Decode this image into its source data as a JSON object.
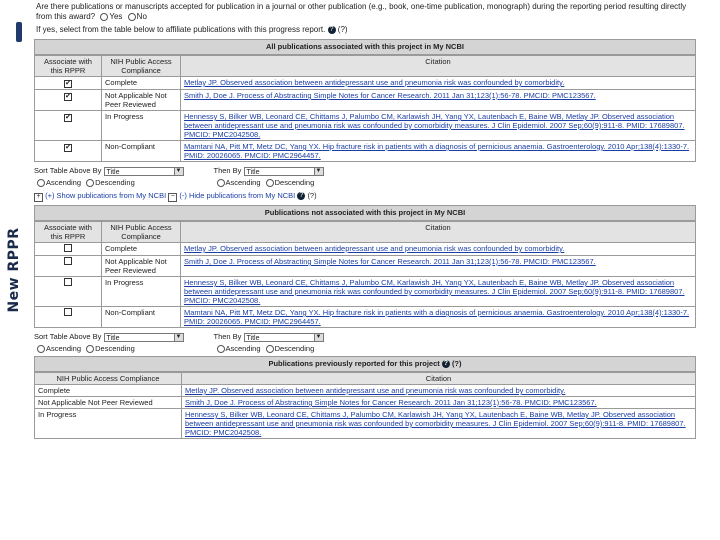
{
  "slide_title": "New RPPR",
  "question": {
    "text": "Are there publications or manuscripts accepted for publication in a journal or other publication (e.g., book, one-time publication, monograph) during the reporting period resulting directly from this award?",
    "yes": "Yes",
    "no": "No",
    "instruction": "If yes, select from the table below to affiliate publications with this progress report.",
    "help_q": "(?)"
  },
  "table1": {
    "caption": "All publications associated with this project in My NCBI",
    "headers": [
      "Associate with this RPPR",
      "NIH Public Access Compliance",
      "Citation"
    ],
    "rows": [
      {
        "checked": "✔",
        "compliance": "Complete",
        "citation": "Metlay JP. Observed association between antidepressant use and pneumonia risk was confounded by comorbidity."
      },
      {
        "checked": "✔",
        "compliance": "Not Applicable Not Peer Reviewed",
        "citation": "Smith J, Doe J. Process of Abstracting Simple Notes for Cancer Research. 2011 Jan 31;123(1):56-78. PMCID: PMC123567."
      },
      {
        "checked": "✔",
        "compliance": "In Progress",
        "citation": "Hennessy S, Bilker WB, Leonard CE, Chittams J, Palumbo CM, Karlawish JH, Yang YX, Lautenbach E, Baine WB, Metlay JP. Observed association between antidepressant use and pneumonia risk was confounded by comorbidity measures. J Clin Epidemiol. 2007 Sep;60(9):911-8. PMID: 17689807. PMCID: PMC2042508."
      },
      {
        "checked": "✔",
        "compliance": "Non-Compliant",
        "citation": "Mamtani NA, Pitt MT, Metz DC, Yang YX. Hip fracture risk in patients with a diagnosis of pernicious anaemia. Gastroenterology. 2010 Apr;138(4):1330-7. PMID: 20026065. PMCID: PMC2964457."
      }
    ]
  },
  "sort1": {
    "label": "Sort Table Above By",
    "value": "Title",
    "then": "Then By",
    "then_value": "Title",
    "asc": "Ascending",
    "desc": "Descending"
  },
  "links": {
    "show": "(+) Show publications from My NCBI",
    "hide": "(-) Hide publications from My NCBI",
    "help": "(?)"
  },
  "table2": {
    "caption": "Publications not associated with this project in My NCBI",
    "headers": [
      "Associate with this RPPR",
      "NIH Public Access Compliance",
      "Citation"
    ],
    "rows": [
      {
        "compliance": "Complete",
        "citation": "Metlay JP. Observed association between antidepressant use and pneumonia risk was confounded by comorbidity."
      },
      {
        "compliance": "Not Applicable Not Peer Reviewed",
        "citation": "Smith J, Doe J. Process of Abstracting Simple Notes for Cancer Research. 2011 Jan 31;123(1):56-78. PMCID: PMC123567."
      },
      {
        "compliance": "In Progress",
        "citation": "Hennessy S, Bilker WB, Leonard CE, Chittams J, Palumbo CM, Karlawish JH, Yang YX, Lautenbach E, Baine WB, Metlay JP. Observed association between antidepressant use and pneumonia risk was confounded by comorbidity measures. J Clin Epidemiol. 2007 Sep;60(9):911-8. PMID: 17689807. PMCID: PMC2042508."
      },
      {
        "compliance": "Non-Compliant",
        "citation": "Mamtani NA, Pitt MT, Metz DC, Yang YX. Hip fracture risk in patients with a diagnosis of pernicious anaemia. Gastroenterology. 2010 Apr;138(4):1330-7. PMID: 20026065. PMCID: PMC2964457."
      }
    ]
  },
  "sort2": {
    "label": "Sort Table Above By",
    "value": "Title",
    "then": "Then By",
    "then_value": "Title",
    "asc": "Ascending",
    "desc": "Descending"
  },
  "table3": {
    "caption": "Publications previously reported for this project",
    "help": "(?)",
    "headers": [
      "NIH Public Access Compliance",
      "Citation"
    ],
    "rows": [
      {
        "compliance": "Complete",
        "citation": "Metlay JP. Observed association between antidepressant use and pneumonia risk was confounded by comorbidity."
      },
      {
        "compliance": "Not Applicable Not Peer Reviewed",
        "citation": "Smith J, Doe J. Process of Abstracting Simple Notes for Cancer Research. 2011 Jan 31;123(1):56-78. PMCID: PMC123567."
      },
      {
        "compliance": "In Progress",
        "citation": "Hennessy S, Bilker WB, Leonard CE, Chittams J, Palumbo CM, Karlawish JH, Yang YX, Lautenbach E, Baine WB, Metlay JP. Observed association between antidepressant use and pneumonia risk was confounded by comorbidity measures. J Clin Epidemiol. 2007 Sep;60(9):911-8. PMID: 17689807. PMCID: PMC2042508."
      }
    ]
  }
}
